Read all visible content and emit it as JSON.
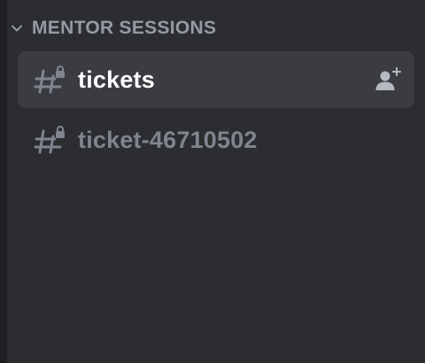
{
  "category": {
    "label": "MENTOR SESSIONS",
    "icon": "chevron-down-icon"
  },
  "channels": [
    {
      "name": "tickets",
      "icon": "locked-text-channel-icon",
      "selected": true,
      "action_icon": "create-invite-icon"
    },
    {
      "name": "ticket-46710502",
      "icon": "locked-text-channel-icon",
      "selected": false
    }
  ],
  "colors": {
    "background": "#2b2d31",
    "selected_row": "#3a3c42",
    "category_text": "#949ba4",
    "active_text": "#ffffff",
    "muted_text": "#80848e"
  }
}
